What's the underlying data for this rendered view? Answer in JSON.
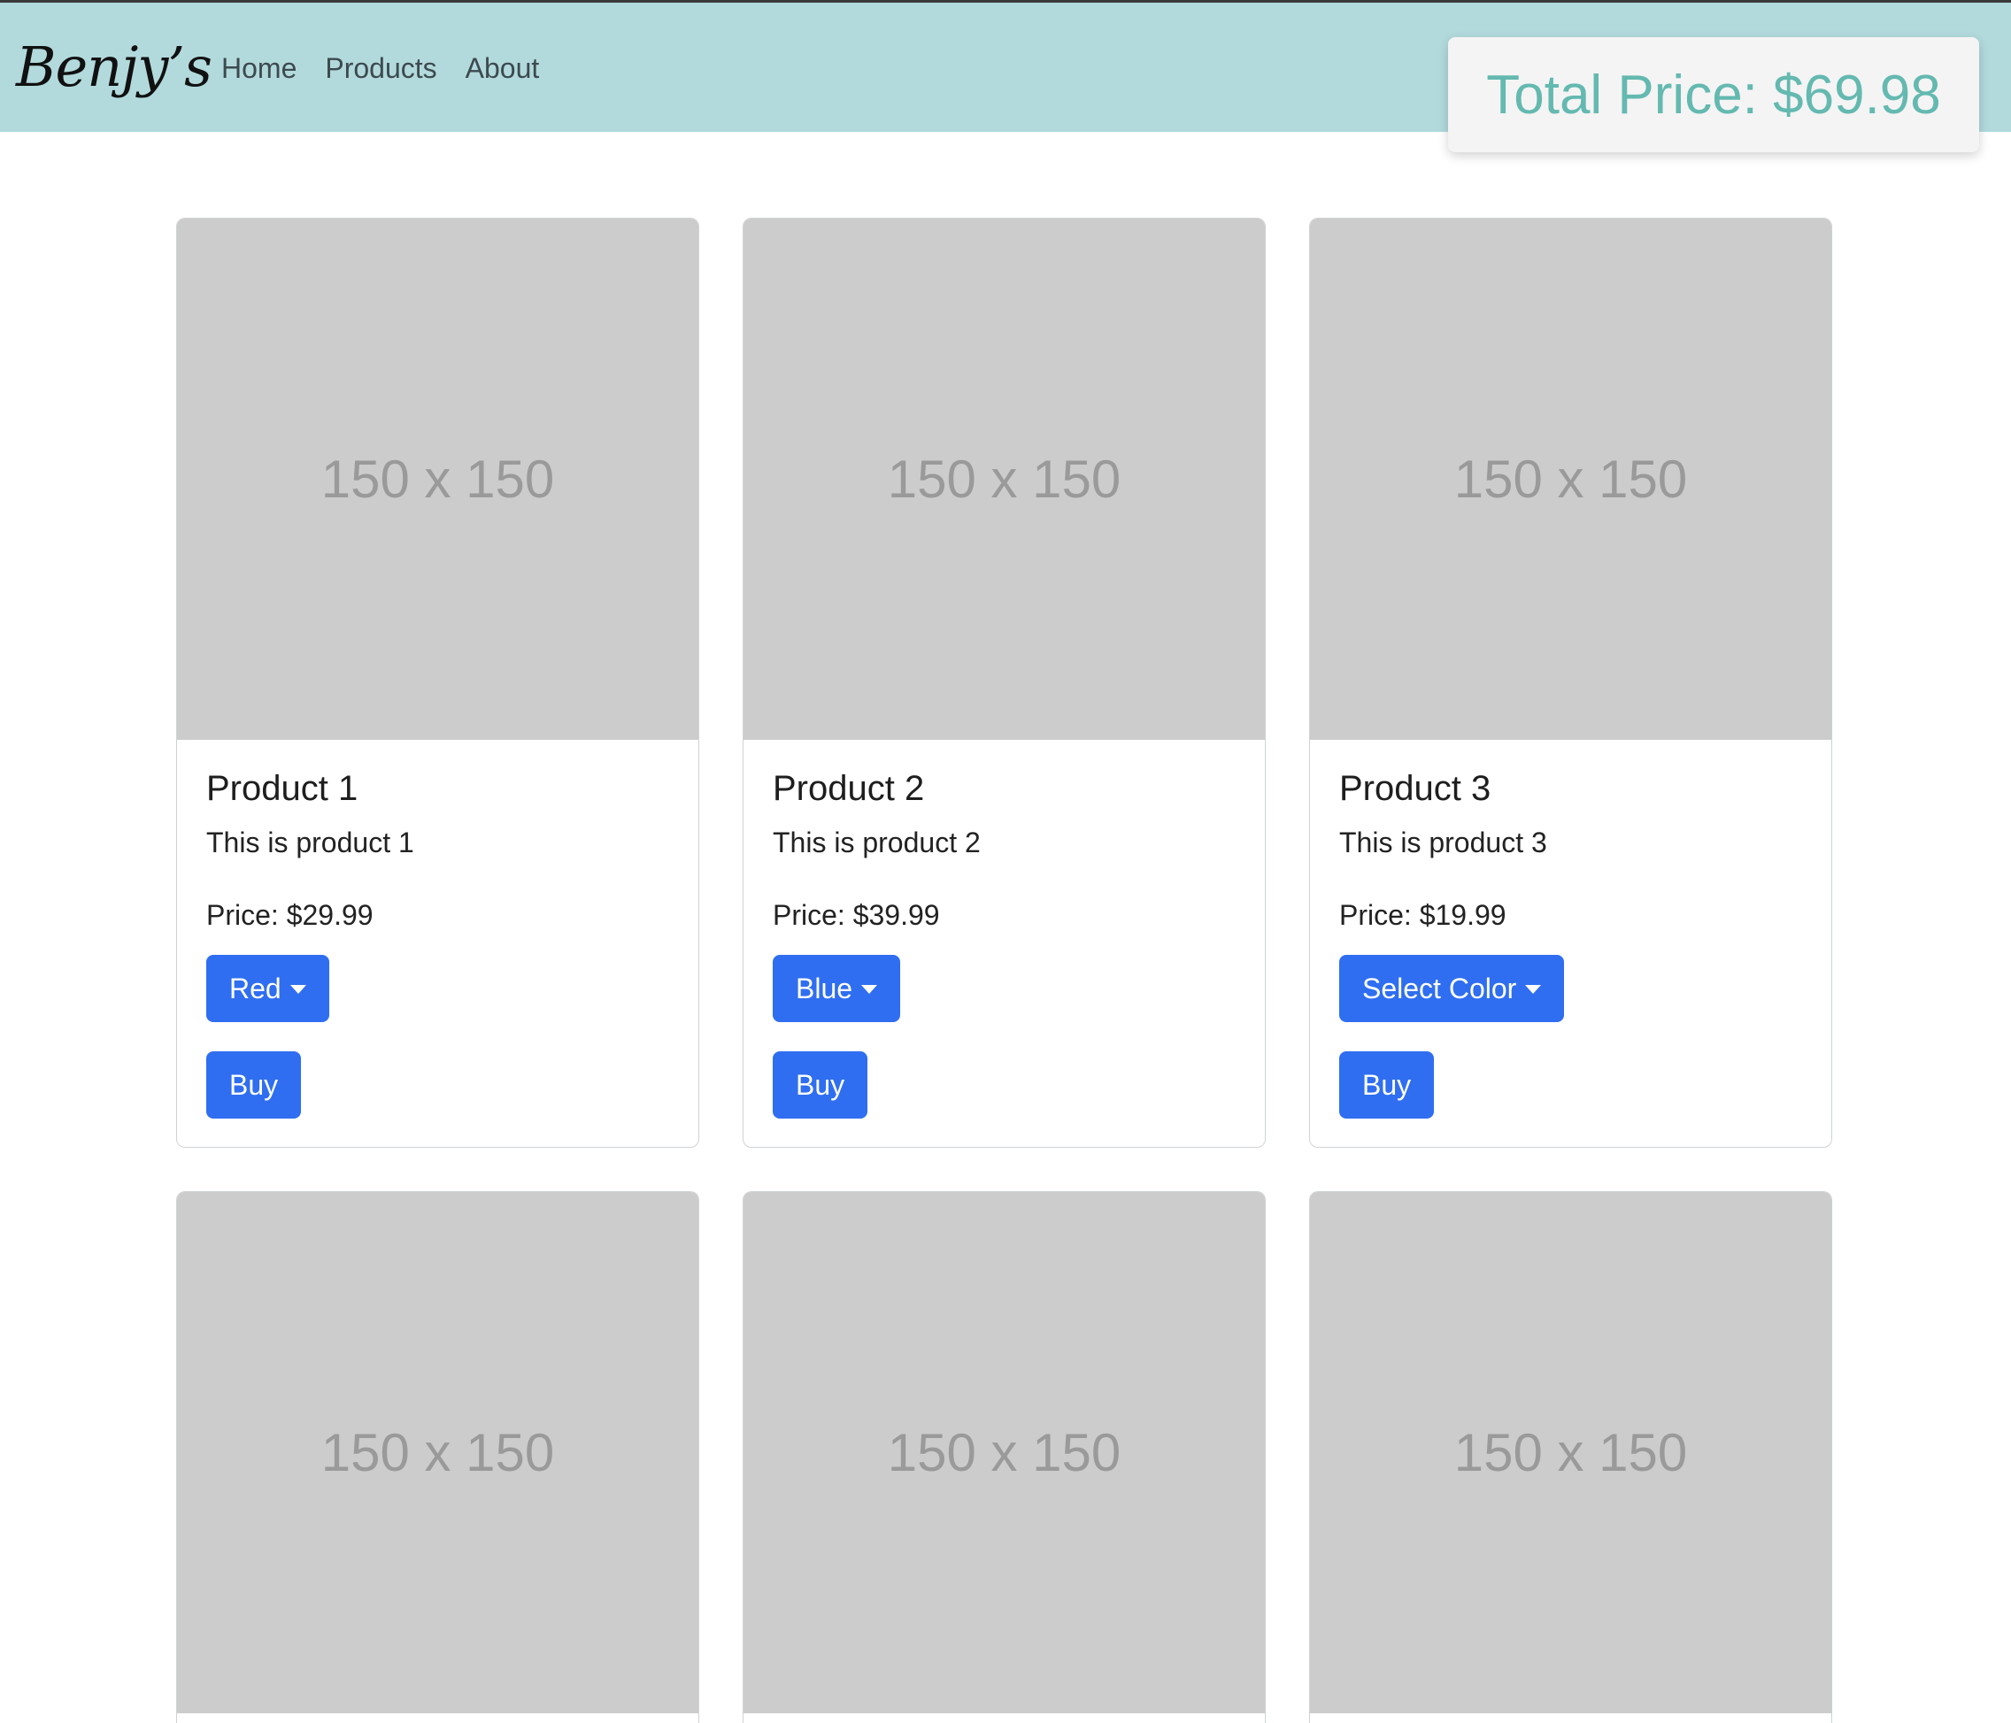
{
  "navbar": {
    "brand": "Benjy’s",
    "links": [
      {
        "label": "Home"
      },
      {
        "label": "Products"
      },
      {
        "label": "About"
      }
    ],
    "total_price": "Total Price: $69.98",
    "colors": {
      "bar": "#b2dadd",
      "total_text": "#64b9b0"
    }
  },
  "products": [
    {
      "image_text": "150 x 150",
      "title": "Product 1",
      "description": "This is product 1",
      "price": "Price: $29.99",
      "color_button": "Red",
      "buy_label": "Buy"
    },
    {
      "image_text": "150 x 150",
      "title": "Product 2",
      "description": "This is product 2",
      "price": "Price: $39.99",
      "color_button": "Blue",
      "buy_label": "Buy"
    },
    {
      "image_text": "150 x 150",
      "title": "Product 3",
      "description": "This is product 3",
      "price": "Price: $19.99",
      "color_button": "Select Color",
      "buy_label": "Buy"
    },
    {
      "image_text": "150 x 150"
    },
    {
      "image_text": "150 x 150"
    },
    {
      "image_text": "150 x 150"
    }
  ],
  "theme": {
    "button": "#2f6ef0",
    "placeholder_bg": "#cccccc"
  },
  "icons": {
    "dropdown": "caret-down-icon"
  }
}
